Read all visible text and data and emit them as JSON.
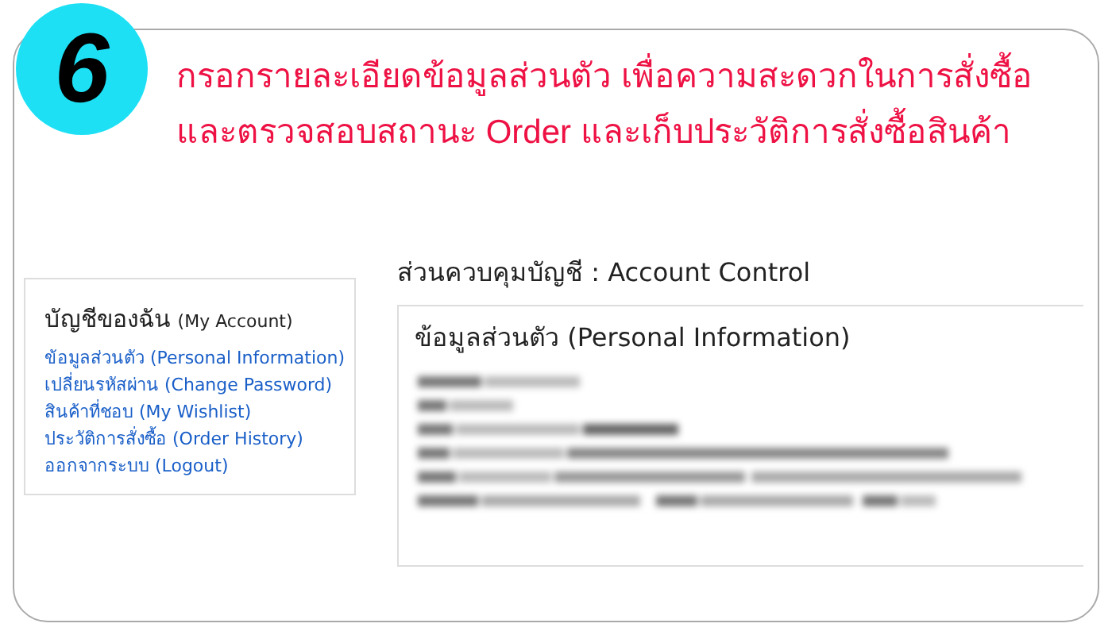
{
  "step_badge": "6",
  "heading_lines": [
    "กรอกรายละเอียดข้อมูลส่วนตัว เพื่อความสะดวกในการสั่งซื้อ",
    "และตรวจสอบสถานะ Order และเก็บประวัติการสั่งซื้อสินค้า"
  ],
  "sidebar": {
    "title": "บัญชีของฉัน",
    "subtitle": "(My Account)",
    "items": [
      {
        "label": "ข้อมูลส่วนตัว (Personal Information)"
      },
      {
        "label": "เปลี่ยนรหัสผ่าน (Change Password)"
      },
      {
        "label": "สินค้าที่ชอบ (My Wishlist)"
      },
      {
        "label": "ประวัติการสั่งซื้อ (Order History)"
      },
      {
        "label": "ออกจากระบบ (Logout)"
      }
    ]
  },
  "main": {
    "title": "ส่วนควบคุมบัญชี : Account Control",
    "card": {
      "title": "ข้อมูลส่วนตัว (Personal Information)",
      "details": {
        "kind": "blurred"
      }
    }
  }
}
